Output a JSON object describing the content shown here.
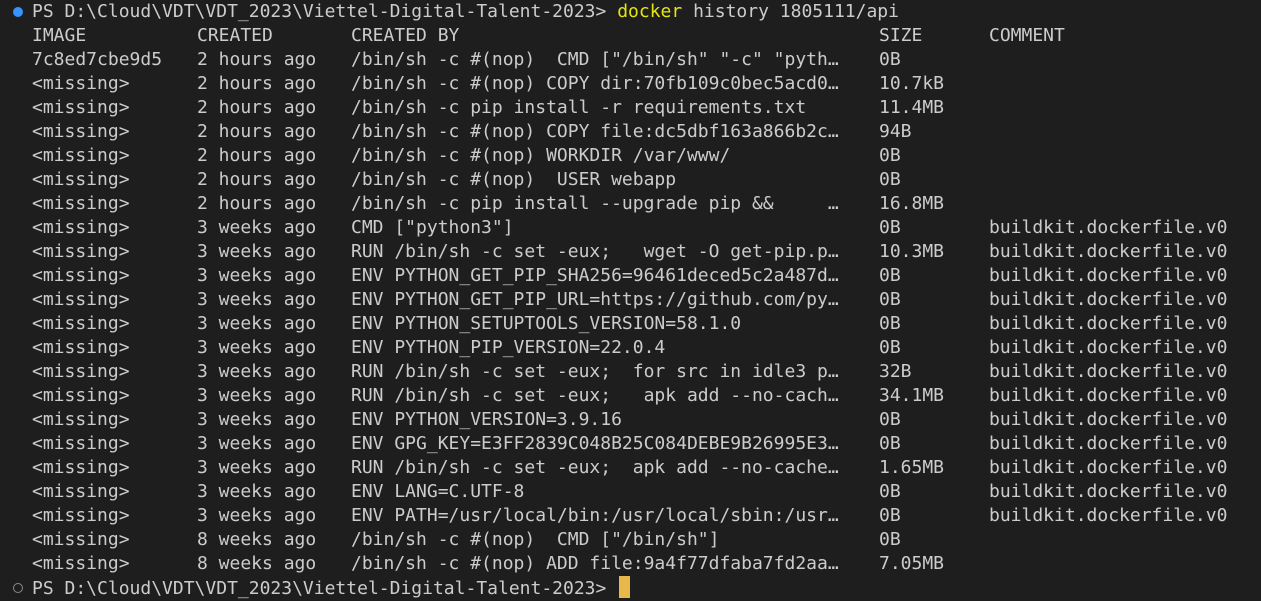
{
  "prompt": {
    "path": "PS D:\\Cloud\\VDT\\VDT_2023\\Viettel-Digital-Talent-2023>",
    "command_word": "docker",
    "command_args": " history 1805111/api"
  },
  "table": {
    "headers": [
      "IMAGE",
      "CREATED",
      "CREATED BY",
      "SIZE",
      "COMMENT"
    ],
    "rows": [
      [
        "7c8ed7cbe9d5",
        "2 hours ago",
        "/bin/sh -c #(nop)  CMD [\"/bin/sh\" \"-c\" \"pyth…",
        "0B",
        ""
      ],
      [
        "<missing>",
        "2 hours ago",
        "/bin/sh -c #(nop) COPY dir:70fb109c0bec5acd0…",
        "10.7kB",
        ""
      ],
      [
        "<missing>",
        "2 hours ago",
        "/bin/sh -c pip install -r requirements.txt",
        "11.4MB",
        ""
      ],
      [
        "<missing>",
        "2 hours ago",
        "/bin/sh -c #(nop) COPY file:dc5dbf163a866b2c…",
        "94B",
        ""
      ],
      [
        "<missing>",
        "2 hours ago",
        "/bin/sh -c #(nop) WORKDIR /var/www/",
        "0B",
        ""
      ],
      [
        "<missing>",
        "2 hours ago",
        "/bin/sh -c #(nop)  USER webapp",
        "0B",
        ""
      ],
      [
        "<missing>",
        "2 hours ago",
        "/bin/sh -c pip install --upgrade pip &&     …",
        "16.8MB",
        ""
      ],
      [
        "<missing>",
        "3 weeks ago",
        "CMD [\"python3\"]",
        "0B",
        "buildkit.dockerfile.v0"
      ],
      [
        "<missing>",
        "3 weeks ago",
        "RUN /bin/sh -c set -eux;   wget -O get-pip.p…",
        "10.3MB",
        "buildkit.dockerfile.v0"
      ],
      [
        "<missing>",
        "3 weeks ago",
        "ENV PYTHON_GET_PIP_SHA256=96461deced5c2a487d…",
        "0B",
        "buildkit.dockerfile.v0"
      ],
      [
        "<missing>",
        "3 weeks ago",
        "ENV PYTHON_GET_PIP_URL=https://github.com/py…",
        "0B",
        "buildkit.dockerfile.v0"
      ],
      [
        "<missing>",
        "3 weeks ago",
        "ENV PYTHON_SETUPTOOLS_VERSION=58.1.0",
        "0B",
        "buildkit.dockerfile.v0"
      ],
      [
        "<missing>",
        "3 weeks ago",
        "ENV PYTHON_PIP_VERSION=22.0.4",
        "0B",
        "buildkit.dockerfile.v0"
      ],
      [
        "<missing>",
        "3 weeks ago",
        "RUN /bin/sh -c set -eux;  for src in idle3 p…",
        "32B",
        "buildkit.dockerfile.v0"
      ],
      [
        "<missing>",
        "3 weeks ago",
        "RUN /bin/sh -c set -eux;   apk add --no-cach…",
        "34.1MB",
        "buildkit.dockerfile.v0"
      ],
      [
        "<missing>",
        "3 weeks ago",
        "ENV PYTHON_VERSION=3.9.16",
        "0B",
        "buildkit.dockerfile.v0"
      ],
      [
        "<missing>",
        "3 weeks ago",
        "ENV GPG_KEY=E3FF2839C048B25C084DEBE9B26995E3…",
        "0B",
        "buildkit.dockerfile.v0"
      ],
      [
        "<missing>",
        "3 weeks ago",
        "RUN /bin/sh -c set -eux;  apk add --no-cache…",
        "1.65MB",
        "buildkit.dockerfile.v0"
      ],
      [
        "<missing>",
        "3 weeks ago",
        "ENV LANG=C.UTF-8",
        "0B",
        "buildkit.dockerfile.v0"
      ],
      [
        "<missing>",
        "3 weeks ago",
        "ENV PATH=/usr/local/bin:/usr/local/sbin:/usr…",
        "0B",
        "buildkit.dockerfile.v0"
      ],
      [
        "<missing>",
        "8 weeks ago",
        "/bin/sh -c #(nop)  CMD [\"/bin/sh\"]",
        "0B",
        ""
      ],
      [
        "<missing>",
        "8 weeks ago",
        "/bin/sh -c #(nop) ADD file:9a4f77dfaba7fd2aa…",
        "7.05MB",
        ""
      ]
    ]
  },
  "final_prompt": {
    "path": "PS D:\\Cloud\\VDT\\VDT_2023\\Viettel-Digital-Talent-2023>"
  },
  "colors": {
    "background": "#1e1e1e",
    "text": "#cccccc",
    "command": "#e5e510",
    "success_dot": "#3794ff",
    "cursor": "#e8b84a"
  }
}
